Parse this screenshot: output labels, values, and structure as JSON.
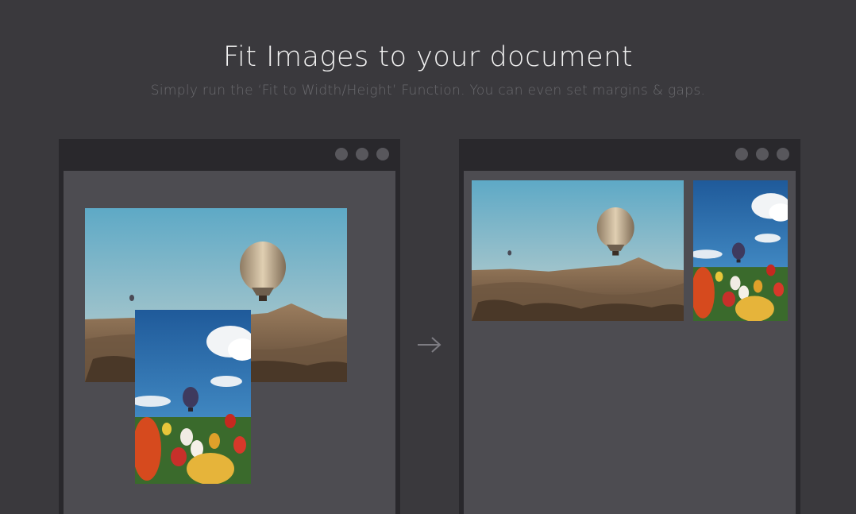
{
  "header": {
    "title": "Fit Images to your document",
    "subtitle": "Simply run the ‘Fit to Width/Height’ Function. You can even set margins & gaps."
  },
  "icons": {
    "window_controls": [
      "window-dot-icon",
      "window-dot-icon",
      "window-dot-icon"
    ],
    "flow": "arrow-right-icon"
  },
  "colors": {
    "background": "#3a393d",
    "window_frame": "#29282c",
    "canvas": "#4d4c51",
    "sky": "#6fb0c4",
    "balloon": "#c9b79a"
  }
}
